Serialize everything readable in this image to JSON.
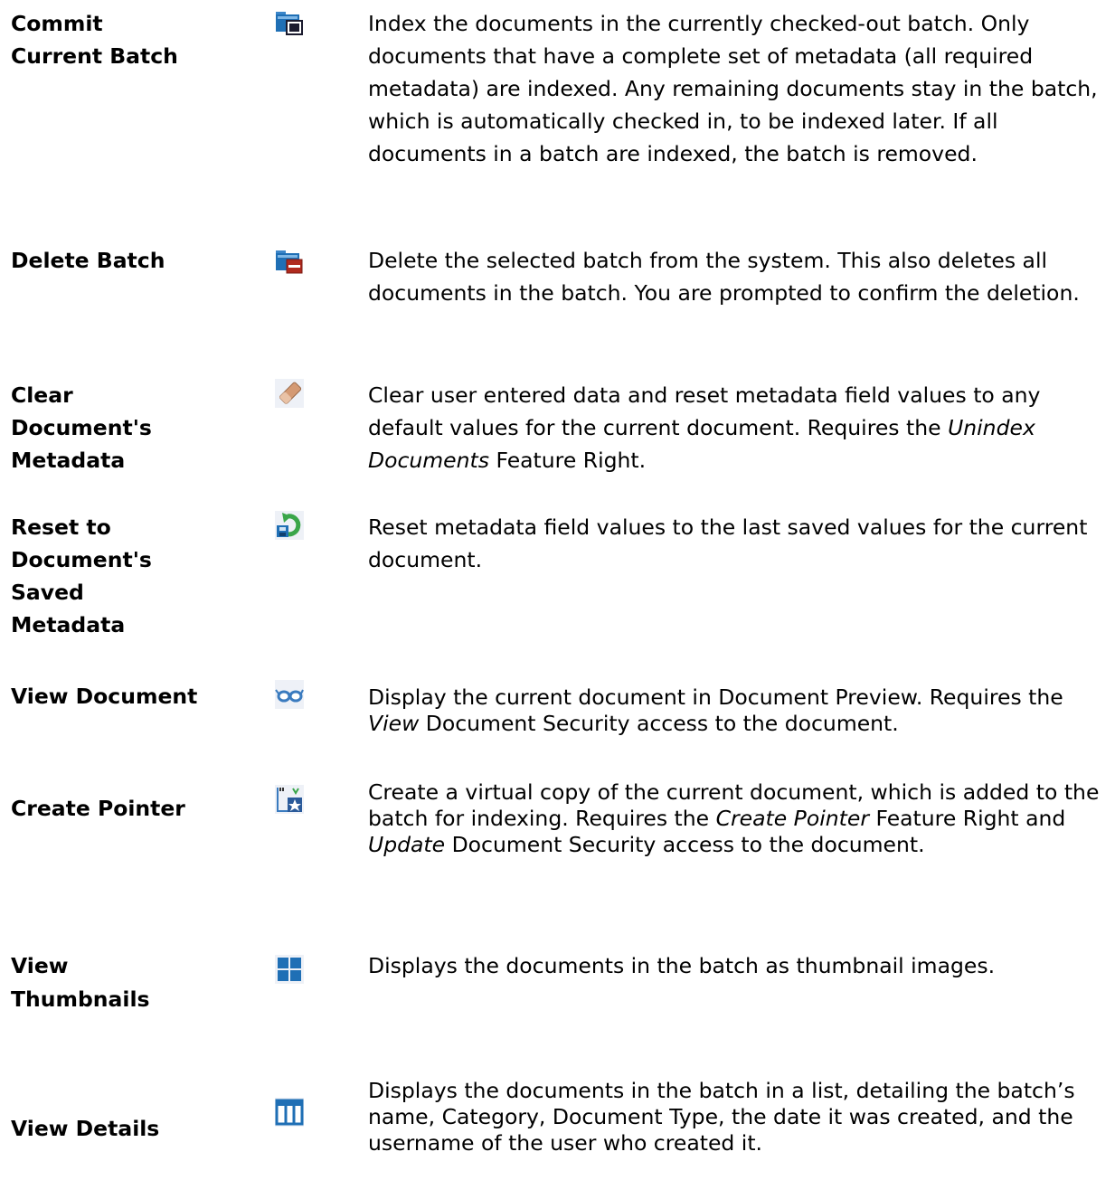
{
  "rows": [
    {
      "id": "commit-current-batch",
      "label": "Commit Current Batch",
      "icon": "commit-batch-icon",
      "description": "Index the documents in the currently checked-out batch. Only documents that have a complete set of metadata (all required metadata) are indexed. Any remaining documents stay in the batch, which is automatically checked in, to be indexed later. If all documents in a batch are indexed, the batch is removed."
    },
    {
      "id": "delete-batch",
      "label": "Delete Batch",
      "icon": "delete-batch-icon",
      "description": "Delete the selected batch from the system. This also deletes all documents in the batch. You are prompted to confirm the deletion."
    },
    {
      "id": "clear-document-metadata",
      "label": "Clear Document's Metadata",
      "icon": "eraser-icon",
      "description_before": "Clear user entered data and reset metadata field values to any default values for the current document. Requires the ",
      "description_italic": "Unindex Documents",
      "description_after": " Feature Right."
    },
    {
      "id": "reset-document-saved-metadata",
      "label": "Reset to Document's Saved Metadata",
      "icon": "reset-saved-icon",
      "description": "Reset metadata field values to the last saved values for the current document."
    },
    {
      "id": "view-document",
      "label": "View Document",
      "icon": "glasses-icon",
      "description_before": "Display the current document in Document Preview. Requires the ",
      "description_italic": "View",
      "description_after": " Document Security access to the document."
    },
    {
      "id": "create-pointer",
      "label": "Create Pointer",
      "icon": "create-pointer-icon",
      "description_part1": "Create a virtual copy of the current document, which is added to the batch for indexing. Requires the ",
      "description_italic1": "Create Pointer",
      "description_part2": " Feature Right and ",
      "description_italic2": "Update",
      "description_part3": " Document Security access to the document."
    },
    {
      "id": "view-thumbnails",
      "label": "View Thumbnails",
      "icon": "thumbnails-icon",
      "description": "Displays the documents in the batch as thumbnail images."
    },
    {
      "id": "view-details",
      "label": "View Details",
      "icon": "details-view-icon",
      "description": "Displays the documents in the batch in a list, detailing the batch’s name, Category, Document Type, the date it was created, and the username of the user who created it."
    }
  ],
  "colors": {
    "icon_blue": "#1f6fb5",
    "icon_dark": "#1a1a2e",
    "icon_red": "#b02a1e",
    "eraser": "#d49a74",
    "green": "#3aa64a"
  }
}
